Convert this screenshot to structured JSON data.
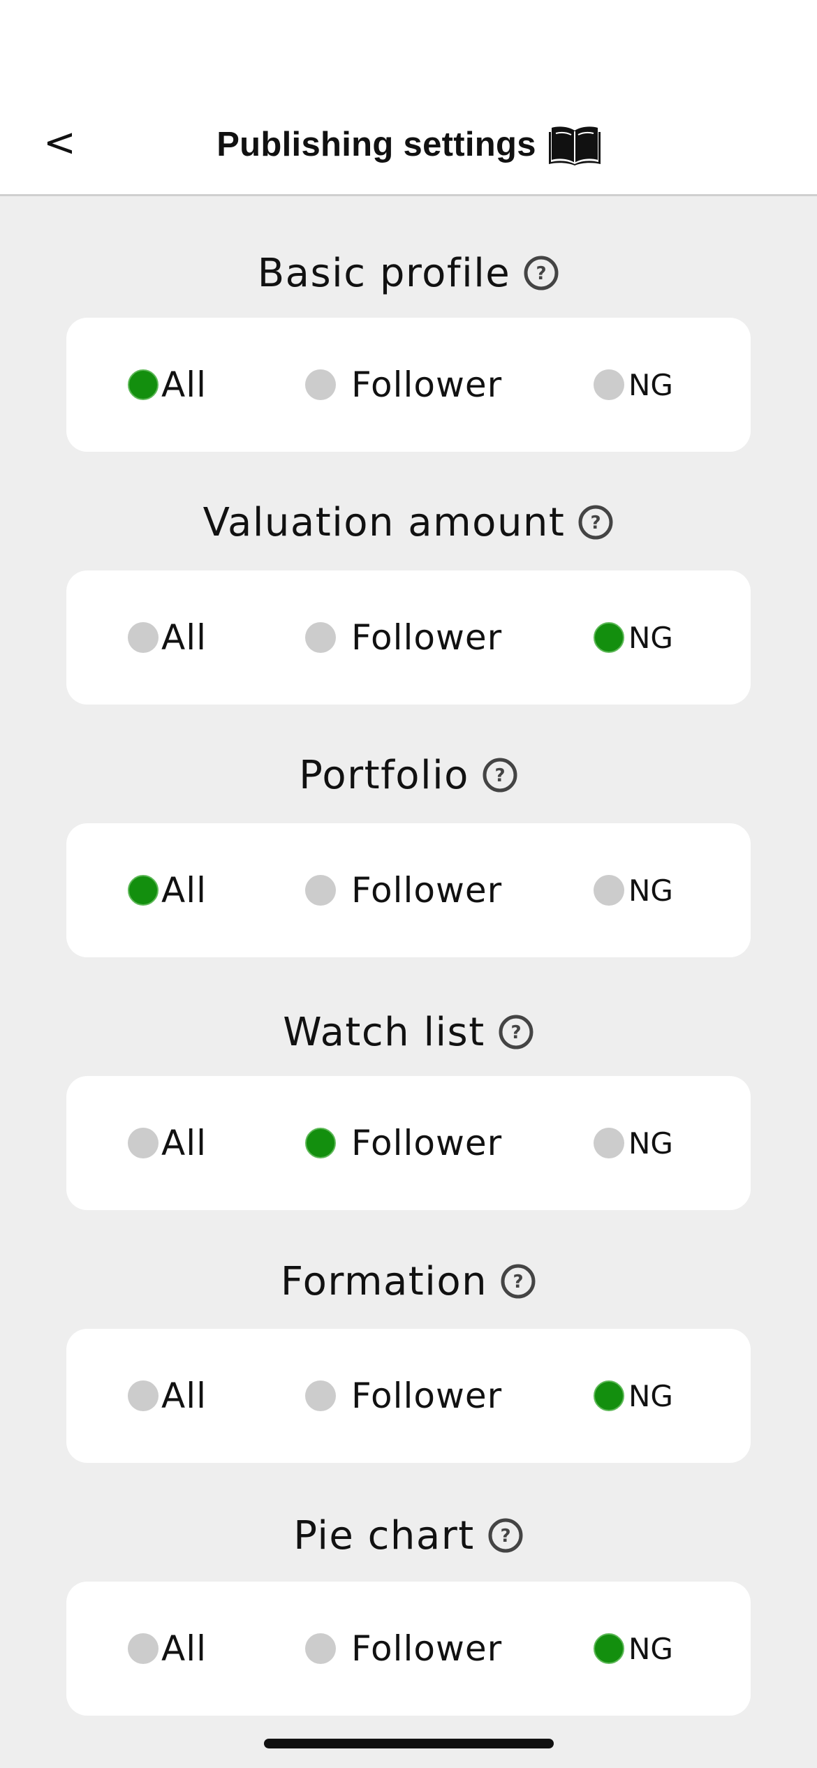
{
  "header": {
    "back_label": "<",
    "title": "Publishing settings",
    "title_icon": "open-book-icon"
  },
  "options": [
    "All",
    "Follower",
    "NG"
  ],
  "colors": {
    "selected": "#138f0e",
    "unselected": "#cccccc",
    "background": "#eeeeee",
    "card": "#ffffff"
  },
  "sections": [
    {
      "title": "Basic profile",
      "selected": "All"
    },
    {
      "title": "Valuation amount",
      "selected": "NG"
    },
    {
      "title": "Portfolio",
      "selected": "All"
    },
    {
      "title": "Watch list",
      "selected": "Follower"
    },
    {
      "title": "Formation",
      "selected": "NG"
    },
    {
      "title": "Pie chart",
      "selected": "NG"
    }
  ]
}
